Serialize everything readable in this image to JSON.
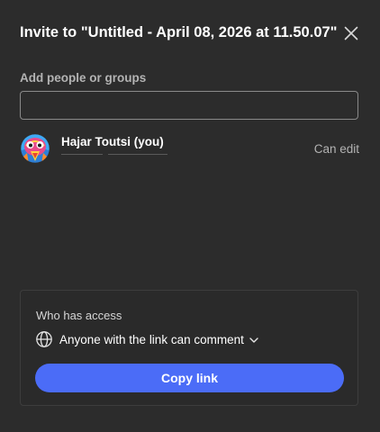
{
  "dialog": {
    "title": "Invite to \"Untitled - April 08, 2026 at 11.50.07\"",
    "close_icon": "close-icon"
  },
  "invite": {
    "label": "Add people or groups",
    "value": ""
  },
  "collaborators": [
    {
      "name": "Hajar Toutsi (you)",
      "permission": "Can edit",
      "avatar_icon": "avatar-illustration"
    }
  ],
  "access": {
    "label": "Who has access",
    "globe_icon": "globe-icon",
    "setting": "Anyone with the link can comment",
    "dropdown_icon": "chevron-down-icon",
    "copy_label": "Copy link"
  },
  "colors": {
    "background": "#2c2c2c",
    "accent": "#4b6cf7",
    "muted_text": "#b3b3b3",
    "input_border": "#8a8a8a"
  }
}
